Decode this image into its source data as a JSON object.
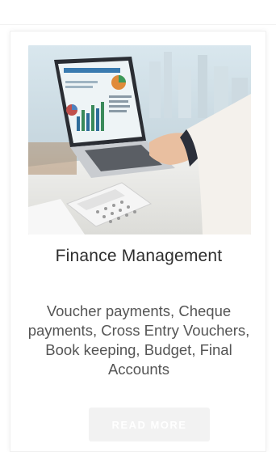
{
  "card": {
    "title": "Finance Management",
    "description": "Voucher payments, Cheque payments, Cross Entry Vouchers, Book keeping, Budget, Final Accounts",
    "button_label": "READ MORE",
    "image": "laptop-finance-dashboard-photo"
  },
  "colors": {
    "title": "#2d2d2d",
    "description": "#555555",
    "button_bg": "#f2f2f2",
    "button_text": "#ffffff"
  }
}
